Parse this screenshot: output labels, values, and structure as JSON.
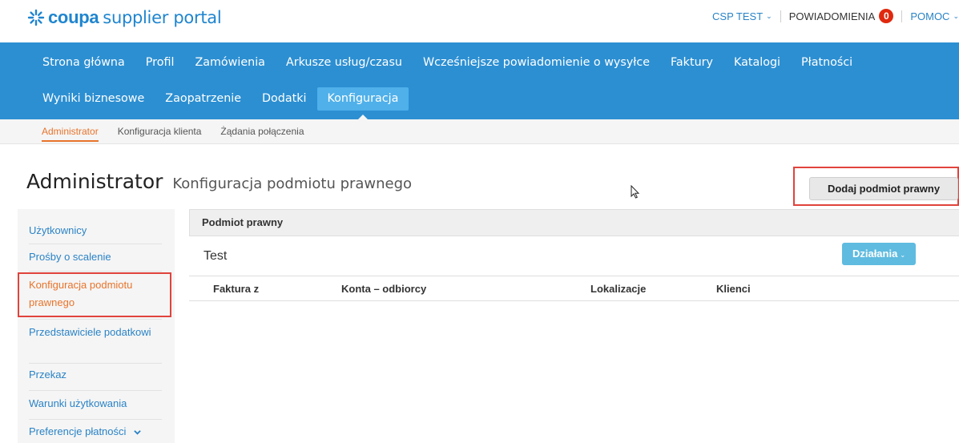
{
  "header": {
    "logo_brand": "coupa",
    "logo_sub": "supplier portal",
    "account_label": "CSP TEST",
    "notifications_label": "POWIADOMIENIA",
    "notifications_count": "0",
    "help_label": "POMOC",
    "logo_color": "#1f85cf"
  },
  "main_nav": {
    "row1": [
      "Strona główna",
      "Profil",
      "Zamówienia",
      "Arkusze usług/czasu",
      "Wcześniejsze powiadomienie o wysyłce",
      "Faktury",
      "Katalogi",
      "Płatności"
    ],
    "row2": [
      "Wyniki biznesowe",
      "Zaopatrzenie",
      "Dodatki",
      "Konfiguracja"
    ],
    "active": "Konfiguracja",
    "bg_color": "#2c8fd2",
    "active_color": "#4fb0ea"
  },
  "sub_nav": {
    "items": [
      "Administrator",
      "Konfiguracja klienta",
      "Żądania połączenia"
    ],
    "active": "Administrator",
    "active_color": "#e8742b"
  },
  "page": {
    "title": "Administrator",
    "subtitle": "Konfiguracja podmiotu prawnego",
    "add_button_label": "Dodaj podmiot prawny"
  },
  "sidebar": {
    "items": [
      {
        "label": "Użytkownicy"
      },
      {
        "label": "Prośby o scalenie"
      },
      {
        "label": "Konfiguracja podmiotu prawnego"
      },
      {
        "label": "Przedstawiciele podatkowi"
      },
      {
        "label": "Przekaz"
      },
      {
        "label": "Warunki użytkowania"
      },
      {
        "label": "Preferencje płatności"
      }
    ],
    "active": "Konfiguracja podmiotu prawnego"
  },
  "panel": {
    "section_label": "Podmiot prawny",
    "entity_name": "Test",
    "actions_label": "Działania",
    "columns": [
      "Faktura z",
      "Konta – odbiorcy",
      "Lokalizacje",
      "Klienci"
    ]
  },
  "icons": {
    "logo": "coupa-burst-icon",
    "caret": "chevron-down-icon",
    "cursor": "mouse-pointer-icon"
  },
  "highlight_color": "#e0433c"
}
